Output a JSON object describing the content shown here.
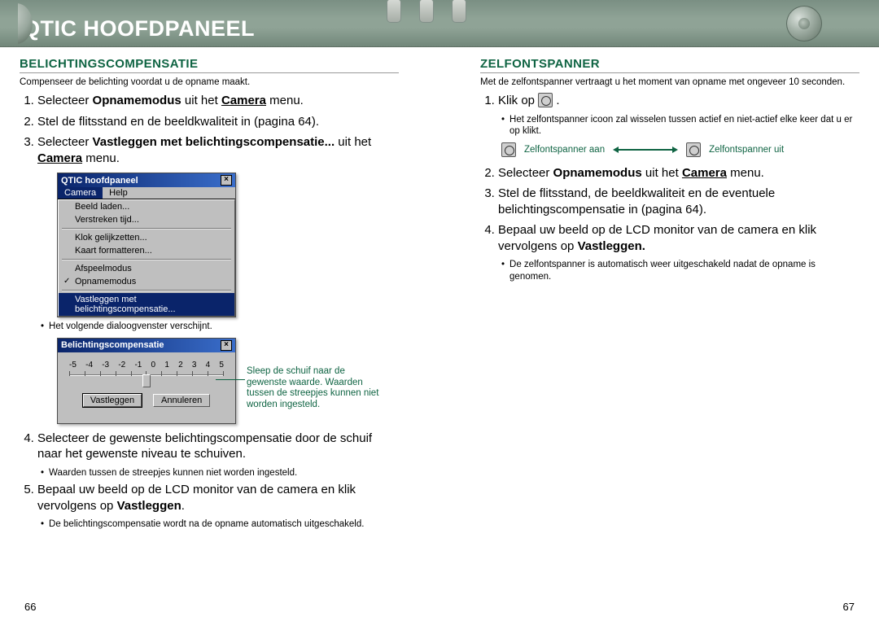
{
  "header": {
    "title": "QTIC HOOFDPANEEL"
  },
  "left": {
    "section_title": "BELICHTINGSCOMPENSATIE",
    "intro": "Compenseer de belichting voordat u de opname maakt.",
    "step1_a": "Selecteer ",
    "step1_b": "Opnamemodus",
    "step1_c": " uit het ",
    "step1_d": "Camera",
    "step1_e": " menu.",
    "step2": "Stel de flitsstand en de beeldkwaliteit in (pagina 64).",
    "step3_a": "Selecteer ",
    "step3_b": "Vastleggen  met belichtingscompensatie...",
    "step3_c": " uit het ",
    "step3_d": "Camera",
    "step3_e": " menu.",
    "menu": {
      "title": "QTIC hoofdpaneel",
      "menubar": {
        "camera": "Camera",
        "help": "Help"
      },
      "items": [
        "Beeld laden...",
        "Verstreken tijd...",
        "Klok gelijkzetten...",
        "Kaart formatteren...",
        "Afspeelmodus",
        "Opnamemodus",
        "Vastleggen met belichtingscompensatie..."
      ]
    },
    "note_dialog": "Het volgende dialoogvenster verschijnt.",
    "slider": {
      "title": "Belichtingscompensatie",
      "ticks": [
        "-5",
        "-4",
        "-3",
        "-2",
        "-1",
        "0",
        "1",
        "2",
        "3",
        "4",
        "5"
      ],
      "btn_ok": "Vastleggen",
      "btn_cancel": "Annuleren",
      "caption": "Sleep de schuif naar de gewenste waarde. Waarden tussen de streepjes kunnen niet worden ingesteld."
    },
    "step4": "Selecteer de gewenste belichtingscompensatie door de schuif naar het gewenste niveau te schuiven.",
    "note_between": "Waarden tussen de streepjes kunnen niet worden ingesteld.",
    "step5_a": "Bepaal uw beeld op de LCD monitor van de camera en klik vervolgens op ",
    "step5_b": "Vastleggen",
    "step5_c": ".",
    "note_auto_off": "De belichtingscompensatie wordt na de opname automatisch uitgeschakeld.",
    "page": "66"
  },
  "right": {
    "section_title": "ZELFONTSPANNER",
    "intro": "Met de zelfontspanner vertraagt u het moment van opname met ongeveer 10 seconden.",
    "step1_a": "Klik op ",
    "note_toggle": "Het zelfontspanner icoon zal wisselen tussen actief en niet-actief elke keer dat u er op klikt.",
    "timer_on": "Zelfontspanner aan",
    "timer_off": "Zelfontspanner uit",
    "step2_a": "Selecteer ",
    "step2_b": "Opnamemodus",
    "step2_c": " uit het ",
    "step2_d": "Camera",
    "step2_e": "  menu.",
    "step3": "Stel de flitsstand, de beeldkwaliteit en de eventuele belichtingscompensatie in (pagina 64).",
    "step4_a": "Bepaal uw beeld op de LCD monitor van de camera en klik vervolgens op ",
    "step4_b": "Vastleggen.",
    "note_auto_off": "De zelfontspanner is automatisch weer uitgeschakeld nadat de opname is genomen.",
    "page": "67"
  }
}
